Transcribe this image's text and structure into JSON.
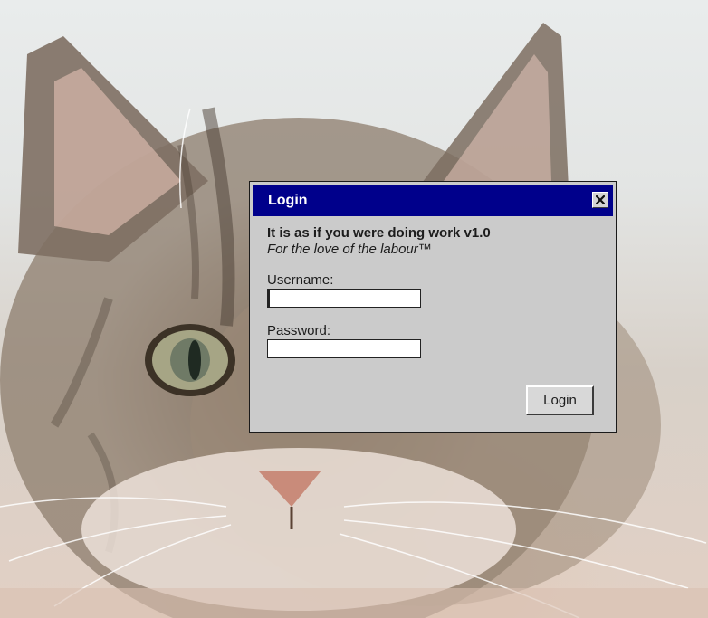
{
  "window": {
    "title": "Login",
    "close_icon": "close-icon"
  },
  "app": {
    "name": "It is as if you were doing work v1.0",
    "tagline": "For the love of the labour™"
  },
  "form": {
    "username_label": "Username:",
    "username_value": "",
    "password_label": "Password:",
    "password_value": "",
    "submit_label": "Login"
  },
  "background": {
    "subject": "cat-photo"
  },
  "colors": {
    "titlebar": "#00008b",
    "window": "#cbcbcb",
    "title_text": "#ffffff"
  }
}
